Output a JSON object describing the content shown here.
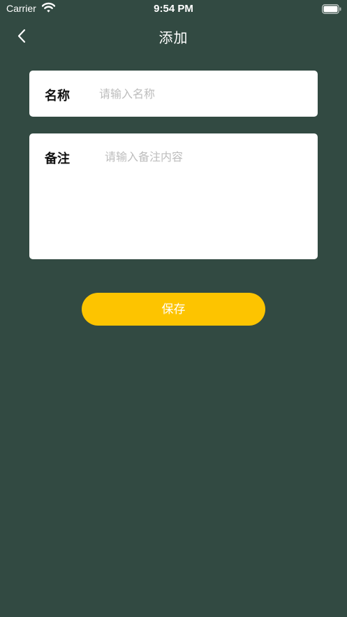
{
  "status_bar": {
    "carrier": "Carrier",
    "time": "9:54 PM",
    "wifi_icon": "wifi-icon",
    "battery_icon": "battery-icon"
  },
  "nav": {
    "title": "添加",
    "back_icon": "chevron-left-icon"
  },
  "form": {
    "name": {
      "label": "名称",
      "value": "",
      "placeholder": "请输入名称"
    },
    "note": {
      "label": "备注",
      "value": "",
      "placeholder": "请输入备注内容"
    }
  },
  "actions": {
    "save_label": "保存"
  },
  "colors": {
    "background": "#324a42",
    "card": "#ffffff",
    "accent": "#fdc400",
    "placeholder": "#bdbdbd"
  }
}
